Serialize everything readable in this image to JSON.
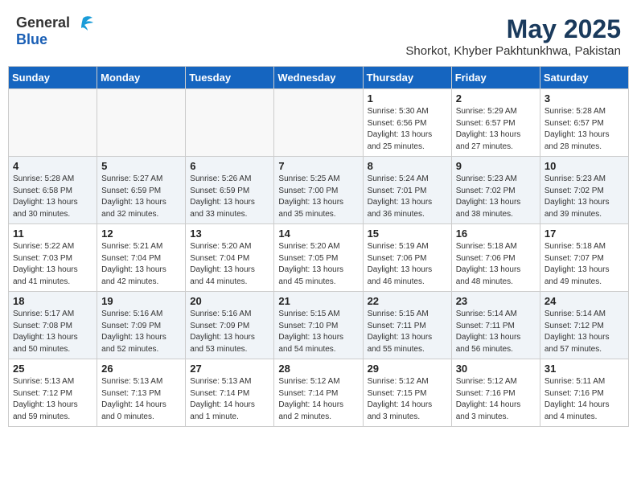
{
  "header": {
    "logo_general": "General",
    "logo_blue": "Blue",
    "title": "May 2025",
    "subtitle": "Shorkot, Khyber Pakhtunkhwa, Pakistan"
  },
  "weekdays": [
    "Sunday",
    "Monday",
    "Tuesday",
    "Wednesday",
    "Thursday",
    "Friday",
    "Saturday"
  ],
  "weeks": [
    [
      {
        "day": "",
        "info": ""
      },
      {
        "day": "",
        "info": ""
      },
      {
        "day": "",
        "info": ""
      },
      {
        "day": "",
        "info": ""
      },
      {
        "day": "1",
        "info": "Sunrise: 5:30 AM\nSunset: 6:56 PM\nDaylight: 13 hours\nand 25 minutes."
      },
      {
        "day": "2",
        "info": "Sunrise: 5:29 AM\nSunset: 6:57 PM\nDaylight: 13 hours\nand 27 minutes."
      },
      {
        "day": "3",
        "info": "Sunrise: 5:28 AM\nSunset: 6:57 PM\nDaylight: 13 hours\nand 28 minutes."
      }
    ],
    [
      {
        "day": "4",
        "info": "Sunrise: 5:28 AM\nSunset: 6:58 PM\nDaylight: 13 hours\nand 30 minutes."
      },
      {
        "day": "5",
        "info": "Sunrise: 5:27 AM\nSunset: 6:59 PM\nDaylight: 13 hours\nand 32 minutes."
      },
      {
        "day": "6",
        "info": "Sunrise: 5:26 AM\nSunset: 6:59 PM\nDaylight: 13 hours\nand 33 minutes."
      },
      {
        "day": "7",
        "info": "Sunrise: 5:25 AM\nSunset: 7:00 PM\nDaylight: 13 hours\nand 35 minutes."
      },
      {
        "day": "8",
        "info": "Sunrise: 5:24 AM\nSunset: 7:01 PM\nDaylight: 13 hours\nand 36 minutes."
      },
      {
        "day": "9",
        "info": "Sunrise: 5:23 AM\nSunset: 7:02 PM\nDaylight: 13 hours\nand 38 minutes."
      },
      {
        "day": "10",
        "info": "Sunrise: 5:23 AM\nSunset: 7:02 PM\nDaylight: 13 hours\nand 39 minutes."
      }
    ],
    [
      {
        "day": "11",
        "info": "Sunrise: 5:22 AM\nSunset: 7:03 PM\nDaylight: 13 hours\nand 41 minutes."
      },
      {
        "day": "12",
        "info": "Sunrise: 5:21 AM\nSunset: 7:04 PM\nDaylight: 13 hours\nand 42 minutes."
      },
      {
        "day": "13",
        "info": "Sunrise: 5:20 AM\nSunset: 7:04 PM\nDaylight: 13 hours\nand 44 minutes."
      },
      {
        "day": "14",
        "info": "Sunrise: 5:20 AM\nSunset: 7:05 PM\nDaylight: 13 hours\nand 45 minutes."
      },
      {
        "day": "15",
        "info": "Sunrise: 5:19 AM\nSunset: 7:06 PM\nDaylight: 13 hours\nand 46 minutes."
      },
      {
        "day": "16",
        "info": "Sunrise: 5:18 AM\nSunset: 7:06 PM\nDaylight: 13 hours\nand 48 minutes."
      },
      {
        "day": "17",
        "info": "Sunrise: 5:18 AM\nSunset: 7:07 PM\nDaylight: 13 hours\nand 49 minutes."
      }
    ],
    [
      {
        "day": "18",
        "info": "Sunrise: 5:17 AM\nSunset: 7:08 PM\nDaylight: 13 hours\nand 50 minutes."
      },
      {
        "day": "19",
        "info": "Sunrise: 5:16 AM\nSunset: 7:09 PM\nDaylight: 13 hours\nand 52 minutes."
      },
      {
        "day": "20",
        "info": "Sunrise: 5:16 AM\nSunset: 7:09 PM\nDaylight: 13 hours\nand 53 minutes."
      },
      {
        "day": "21",
        "info": "Sunrise: 5:15 AM\nSunset: 7:10 PM\nDaylight: 13 hours\nand 54 minutes."
      },
      {
        "day": "22",
        "info": "Sunrise: 5:15 AM\nSunset: 7:11 PM\nDaylight: 13 hours\nand 55 minutes."
      },
      {
        "day": "23",
        "info": "Sunrise: 5:14 AM\nSunset: 7:11 PM\nDaylight: 13 hours\nand 56 minutes."
      },
      {
        "day": "24",
        "info": "Sunrise: 5:14 AM\nSunset: 7:12 PM\nDaylight: 13 hours\nand 57 minutes."
      }
    ],
    [
      {
        "day": "25",
        "info": "Sunrise: 5:13 AM\nSunset: 7:12 PM\nDaylight: 13 hours\nand 59 minutes."
      },
      {
        "day": "26",
        "info": "Sunrise: 5:13 AM\nSunset: 7:13 PM\nDaylight: 14 hours\nand 0 minutes."
      },
      {
        "day": "27",
        "info": "Sunrise: 5:13 AM\nSunset: 7:14 PM\nDaylight: 14 hours\nand 1 minute."
      },
      {
        "day": "28",
        "info": "Sunrise: 5:12 AM\nSunset: 7:14 PM\nDaylight: 14 hours\nand 2 minutes."
      },
      {
        "day": "29",
        "info": "Sunrise: 5:12 AM\nSunset: 7:15 PM\nDaylight: 14 hours\nand 3 minutes."
      },
      {
        "day": "30",
        "info": "Sunrise: 5:12 AM\nSunset: 7:16 PM\nDaylight: 14 hours\nand 3 minutes."
      },
      {
        "day": "31",
        "info": "Sunrise: 5:11 AM\nSunset: 7:16 PM\nDaylight: 14 hours\nand 4 minutes."
      }
    ]
  ]
}
